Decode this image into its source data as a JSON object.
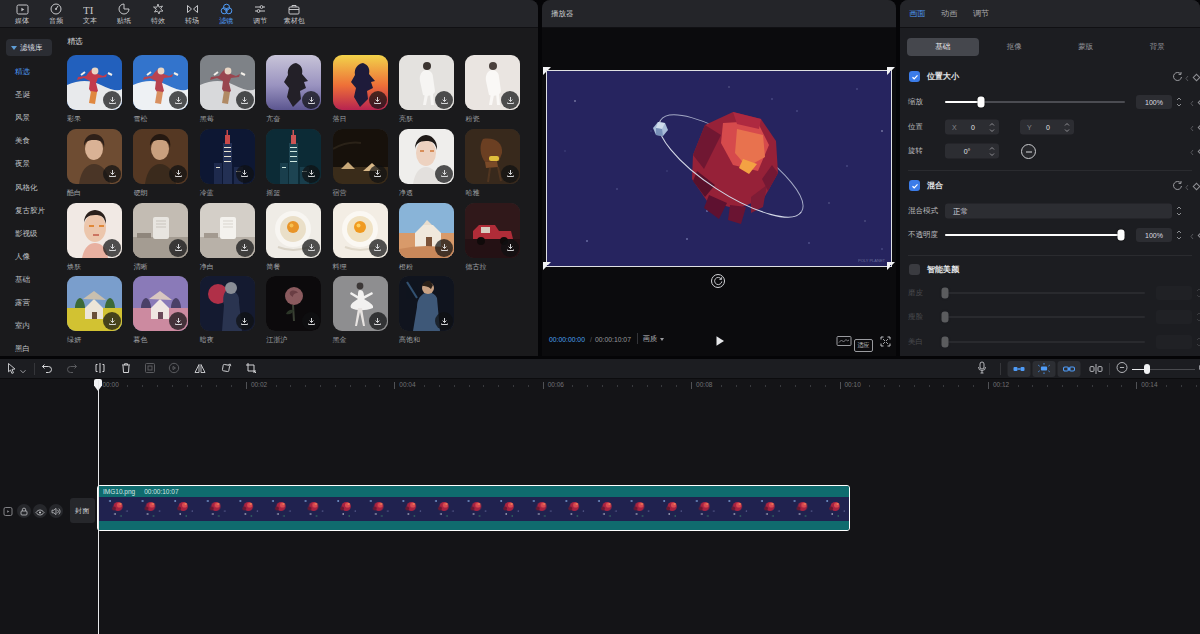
{
  "colors": {
    "accent_blue": "#4f9cf8",
    "panel_header_bg": "#242529",
    "left_panel_bg": "#1a1a1c",
    "props_panel_bg": "#1c1d21",
    "player_bg": "#0b0b0d",
    "timeline_bg": "#141417",
    "clip_teal": "#0f6b6e",
    "clip_film_navy": "#20224f",
    "video_navy": "#26245f",
    "timecode_cyan": "#4aa0ee"
  },
  "media_toolbar": {
    "items": [
      {
        "label": "媒体",
        "icon": "media-icon"
      },
      {
        "label": "音频",
        "icon": "audio-icon"
      },
      {
        "label": "文本",
        "icon": "text-icon"
      },
      {
        "label": "贴纸",
        "icon": "sticker-icon"
      },
      {
        "label": "特效",
        "icon": "effects-icon"
      },
      {
        "label": "转场",
        "icon": "transition-icon"
      },
      {
        "label": "滤镜",
        "icon": "filter-icon"
      },
      {
        "label": "调节",
        "icon": "adjust-icon"
      },
      {
        "label": "素材包",
        "icon": "package-icon"
      }
    ],
    "active_label": "滤镜"
  },
  "filter_library": {
    "dropdown_label": "滤镜库",
    "categories": [
      "精选",
      "圣诞",
      "风景",
      "美食",
      "夜景",
      "风格化",
      "复古胶片",
      "影视级",
      "人像",
      "基础",
      "露营",
      "室内",
      "黑白"
    ],
    "active_category": "精选",
    "section_title": "精选",
    "filters": [
      {
        "name": "彩果",
        "art": "skier_blue"
      },
      {
        "name": "雪松",
        "art": "skier_cyan"
      },
      {
        "name": "黑莓",
        "art": "skier_gray"
      },
      {
        "name": "亢奋",
        "art": "figure_violet"
      },
      {
        "name": "落日",
        "art": "figure_sunset"
      },
      {
        "name": "亮肤",
        "art": "walk_white"
      },
      {
        "name": "粉瓷",
        "art": "walk_pink"
      },
      {
        "name": "酷白",
        "art": "portrait_warm"
      },
      {
        "name": "硬朗",
        "art": "portrait_dark"
      },
      {
        "name": "冷蓝",
        "art": "city_blue"
      },
      {
        "name": "摇篮",
        "art": "city_teal"
      },
      {
        "name": "宿营",
        "art": "camp"
      },
      {
        "name": "净透",
        "art": "face_white"
      },
      {
        "name": "哈雅",
        "art": "chair"
      },
      {
        "name": "焕肤",
        "art": "skin"
      },
      {
        "name": "清晰",
        "art": "product_gray"
      },
      {
        "name": "净白",
        "art": "product_white"
      },
      {
        "name": "简餐",
        "art": "food_egg"
      },
      {
        "name": "料理",
        "art": "food_egg2"
      },
      {
        "name": "橙粉",
        "art": "desert_house"
      },
      {
        "name": "德古拉",
        "art": "truck"
      },
      {
        "name": "绿妍",
        "art": "house_yellow"
      },
      {
        "name": "暮色",
        "art": "house_pink"
      },
      {
        "name": "暗夜",
        "art": "night_figure"
      },
      {
        "name": "江浙沪",
        "art": "rose"
      },
      {
        "name": "黑金",
        "art": "ballerina"
      },
      {
        "name": "高饱和",
        "art": "man_blue"
      }
    ]
  },
  "player": {
    "title": "播放器",
    "current_time": "00:00:00:00",
    "slash": "/",
    "duration": "00:00:10:07",
    "quality_label": "画质",
    "fit_label": "适应"
  },
  "properties": {
    "tabs": [
      "画面",
      "动画",
      "调节"
    ],
    "active_tab": "画面",
    "subtabs": [
      "基础",
      "抠像",
      "蒙版",
      "背景"
    ],
    "active_subtab": "基础",
    "position_size": {
      "label": "位置大小",
      "checked": true,
      "scale_label": "缩放",
      "scale_value": "100%",
      "scale_percent": 20,
      "position_label": "位置",
      "x_label": "X",
      "x_value": "0",
      "y_label": "Y",
      "y_value": "0",
      "rotate_label": "旋转",
      "rotate_value": "0°"
    },
    "blend": {
      "label": "混合",
      "checked": true,
      "mode_label": "混合模式",
      "mode_value": "正常",
      "opacity_label": "不透明度",
      "opacity_value": "100%",
      "opacity_percent": 98
    },
    "beauty": {
      "label": "智能美颜",
      "checked": false,
      "sliders": [
        "磨皮",
        "瘦脸",
        "美白"
      ]
    }
  },
  "timeline": {
    "ruler_labels": [
      "00:00",
      "00:02",
      "00:04",
      "00:06",
      "00:08",
      "00:10",
      "00:12",
      "00:14"
    ],
    "cover_label": "封面",
    "clip": {
      "name": "IMG10.png",
      "duration": "00:00:10:07"
    }
  }
}
